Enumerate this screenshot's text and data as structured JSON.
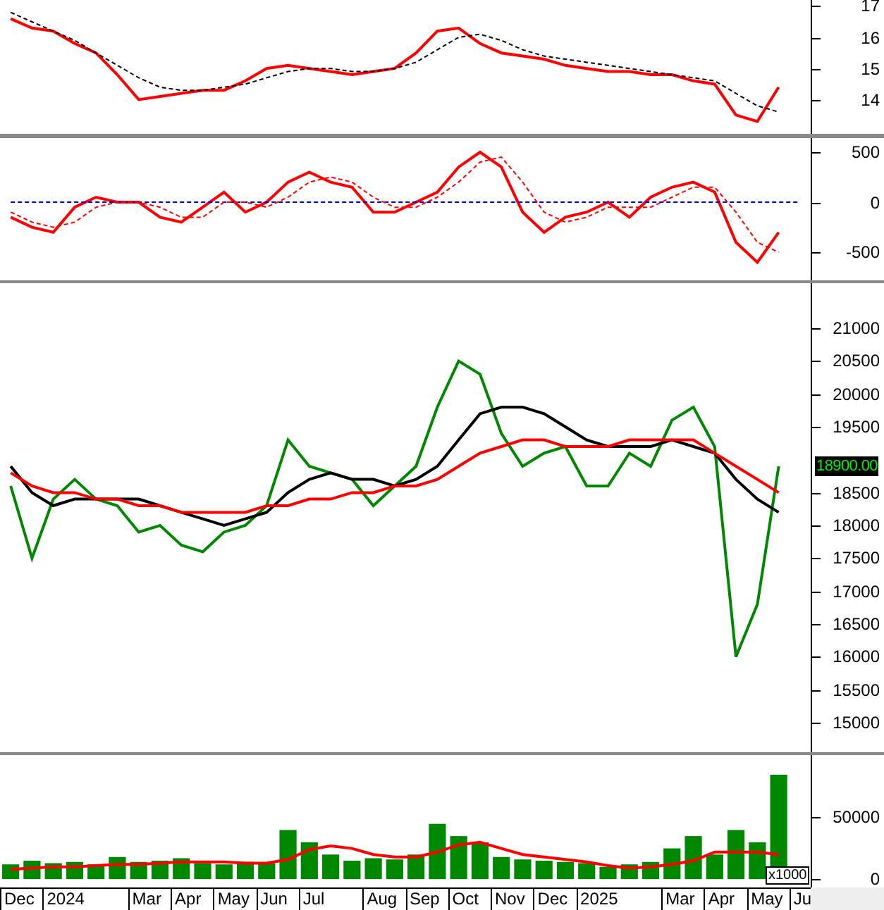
{
  "rsi_panel": {
    "chart_data": {
      "type": "line",
      "categories": [
        null,
        null,
        null,
        null,
        null,
        null,
        null,
        null,
        null,
        null,
        null,
        null,
        null,
        null,
        null,
        null,
        null,
        null,
        null,
        null,
        null,
        null,
        null,
        null,
        null,
        null,
        null,
        null,
        null,
        null,
        null,
        null,
        null,
        null,
        null,
        null,
        null,
        null
      ],
      "ylim": [
        12.9,
        17.2
      ],
      "yticks": [
        14,
        15,
        16,
        17
      ],
      "series": [
        {
          "color": "#ff0000",
          "values": [
            16.6,
            16.3,
            16.2,
            15.8,
            15.5,
            14.8,
            14.0,
            14.1,
            14.2,
            14.3,
            14.3,
            14.6,
            15.0,
            15.1,
            15.0,
            14.9,
            14.8,
            14.9,
            15.0,
            15.5,
            16.2,
            16.3,
            15.8,
            15.5,
            15.4,
            15.3,
            15.1,
            15.0,
            14.9,
            14.9,
            14.8,
            14.8,
            14.6,
            14.5,
            13.5,
            13.3,
            14.4,
            null
          ]
        },
        {
          "color": "#000000",
          "line_style": "dashed",
          "values": [
            16.8,
            16.5,
            16.2,
            15.9,
            15.5,
            15.1,
            14.7,
            14.4,
            14.3,
            14.3,
            14.4,
            14.5,
            14.7,
            14.9,
            15.0,
            15.0,
            14.9,
            14.9,
            15.0,
            15.2,
            15.6,
            16.0,
            16.1,
            15.9,
            15.6,
            15.4,
            15.3,
            15.2,
            15.1,
            15.0,
            14.9,
            14.8,
            14.7,
            14.6,
            14.2,
            13.8,
            13.6,
            null
          ]
        }
      ]
    }
  },
  "oscillator_panel": {
    "chart_data": {
      "type": "line",
      "categories": [
        null,
        null,
        null,
        null,
        null,
        null,
        null,
        null,
        null,
        null,
        null,
        null,
        null,
        null,
        null,
        null,
        null,
        null,
        null,
        null,
        null,
        null,
        null,
        null,
        null,
        null,
        null,
        null,
        null,
        null,
        null,
        null,
        null,
        null,
        null,
        null,
        null,
        null
      ],
      "ylim": [
        -780,
        640
      ],
      "yticks": [
        500,
        0,
        -500
      ],
      "series": [
        {
          "color": "#ff0000",
          "values": [
            -150,
            -250,
            -300,
            -50,
            50,
            0,
            0,
            -150,
            -200,
            -50,
            100,
            -100,
            0,
            200,
            300,
            200,
            150,
            -100,
            -100,
            0,
            100,
            350,
            500,
            350,
            -100,
            -300,
            -150,
            -100,
            0,
            -150,
            50,
            150,
            200,
            100,
            -400,
            -600,
            -300,
            null
          ]
        },
        {
          "color": "#0000cc",
          "line_style": "dashed",
          "values": [
            0,
            0,
            0,
            0,
            0,
            0,
            0,
            0,
            0,
            0,
            0,
            0,
            0,
            0,
            0,
            0,
            0,
            0,
            0,
            0,
            0,
            0,
            0,
            0,
            0,
            0,
            0,
            0,
            0,
            0,
            0,
            0,
            0,
            0,
            0,
            0,
            0,
            0
          ]
        },
        {
          "color": "#ff0000",
          "line_style": "dashed",
          "values": [
            -100,
            -200,
            -250,
            -200,
            -50,
            0,
            0,
            -50,
            -150,
            -150,
            0,
            0,
            -50,
            50,
            200,
            250,
            200,
            50,
            -50,
            -50,
            50,
            200,
            400,
            450,
            200,
            -100,
            -200,
            -150,
            -50,
            -50,
            -50,
            50,
            150,
            150,
            -100,
            -400,
            -500,
            null
          ]
        }
      ]
    }
  },
  "price_panel": {
    "last_price": "18900.00",
    "chart_data": {
      "type": "line",
      "categories": [
        null,
        null,
        null,
        null,
        null,
        null,
        null,
        null,
        null,
        null,
        null,
        null,
        null,
        null,
        null,
        null,
        null,
        null,
        null,
        null,
        null,
        null,
        null,
        null,
        null,
        null,
        null,
        null,
        null,
        null,
        null,
        null,
        null,
        null,
        null,
        null,
        null,
        null
      ],
      "ylim": [
        14550,
        21686
      ],
      "yticks": [
        21000,
        20500,
        20000,
        19500,
        18500,
        18000,
        17500,
        17000,
        16500,
        16000,
        15500,
        15000
      ],
      "series": [
        {
          "color": "#008800",
          "values": [
            18600,
            17500,
            18400,
            18700,
            18400,
            18300,
            17900,
            18000,
            17700,
            17600,
            17900,
            18000,
            18300,
            19300,
            18900,
            18800,
            18700,
            18300,
            18600,
            18900,
            19800,
            20500,
            20300,
            19400,
            18900,
            19100,
            19200,
            18600,
            18600,
            19100,
            18900,
            19600,
            19800,
            19200,
            16000,
            16800,
            18900,
            null
          ]
        },
        {
          "color": "#000000",
          "values": [
            18900,
            18500,
            18300,
            18400,
            18400,
            18400,
            18400,
            18300,
            18200,
            18100,
            18000,
            18100,
            18200,
            18500,
            18700,
            18800,
            18700,
            18700,
            18600,
            18700,
            18900,
            19300,
            19700,
            19800,
            19800,
            19700,
            19500,
            19300,
            19200,
            19200,
            19200,
            19300,
            19200,
            19100,
            18700,
            18400,
            18200,
            null
          ]
        },
        {
          "color": "#ff0000",
          "values": [
            18800,
            18600,
            18500,
            18500,
            18400,
            18400,
            18300,
            18300,
            18200,
            18200,
            18200,
            18200,
            18300,
            18300,
            18400,
            18400,
            18500,
            18500,
            18600,
            18600,
            18700,
            18900,
            19100,
            19200,
            19300,
            19300,
            19200,
            19200,
            19200,
            19300,
            19300,
            19300,
            19300,
            19100,
            18900,
            18700,
            18500,
            null
          ]
        }
      ]
    }
  },
  "volume_panel": {
    "unit": "x1000",
    "chart_data": {
      "type": "bar",
      "categories": [
        "Dec",
        null,
        "2024",
        null,
        null,
        null,
        "Mar",
        null,
        "Apr",
        null,
        "May",
        null,
        "Jun",
        null,
        "Jul",
        null,
        null,
        "Aug",
        null,
        "Sep",
        null,
        "Oct",
        null,
        "Nov",
        null,
        "Dec",
        null,
        "2025",
        null,
        null,
        null,
        "Mar",
        null,
        "Apr",
        null,
        "May",
        null,
        "Ju"
      ],
      "ylim": [
        -6800,
        101000
      ],
      "yticks": [
        50000,
        0
      ],
      "series": [
        {
          "color": "#008800",
          "type": "bar",
          "values": [
            12000,
            15000,
            13000,
            14000,
            12000,
            18000,
            14000,
            15000,
            17000,
            13000,
            12000,
            14000,
            13000,
            40000,
            30000,
            20000,
            15000,
            17000,
            16000,
            20000,
            45000,
            35000,
            30000,
            18000,
            16000,
            15000,
            14000,
            13000,
            10000,
            12000,
            14000,
            25000,
            35000,
            20000,
            40000,
            30000,
            85000,
            null
          ]
        },
        {
          "color": "#ff0000",
          "type": "line",
          "values": [
            8000,
            9000,
            10000,
            10000,
            11000,
            12000,
            12000,
            13000,
            14000,
            14000,
            14000,
            13000,
            13000,
            16000,
            24000,
            27000,
            25000,
            20000,
            18000,
            18000,
            22000,
            28000,
            30000,
            25000,
            20000,
            18000,
            16000,
            14000,
            11000,
            9000,
            10000,
            12000,
            15000,
            22000,
            22000,
            22000,
            20000,
            null
          ]
        }
      ]
    }
  }
}
